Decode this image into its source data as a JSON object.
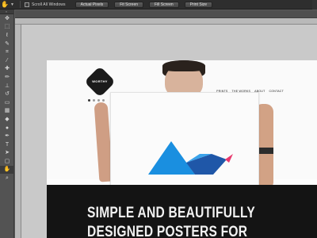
{
  "options_bar": {
    "tool_icon": "hand-icon",
    "scroll_all_windows_label": "Scroll All Windows",
    "buttons": [
      "Actual Pixels",
      "Fit Screen",
      "Fill Screen",
      "Print Size"
    ]
  },
  "tools_panel": {
    "tools": [
      "move-icon",
      "marquee-icon",
      "lasso-icon",
      "quick-select-icon",
      "crop-icon",
      "eyedropper-icon",
      "healing-icon",
      "brush-icon",
      "stamp-icon",
      "history-brush-icon",
      "eraser-icon",
      "gradient-icon",
      "blur-icon",
      "dodge-icon",
      "pen-icon",
      "type-icon",
      "path-select-icon",
      "shape-icon",
      "hand-icon",
      "zoom-icon"
    ],
    "active_tool": "hand-icon"
  },
  "website": {
    "logo_text": "WORTHY",
    "nav": [
      "PRINTS",
      "THE WORKS",
      "ABOUT",
      "CONTACT"
    ],
    "hero_line_1": "SIMPLE AND BEAUTIFULLY",
    "hero_line_2": "DESIGNED POSTERS FOR"
  },
  "colors": {
    "blue_triangle": "#1a8fe0",
    "dark_blue": "#1f57a8",
    "pink_accent": "#e8396d",
    "hero_bg": "#141414"
  }
}
